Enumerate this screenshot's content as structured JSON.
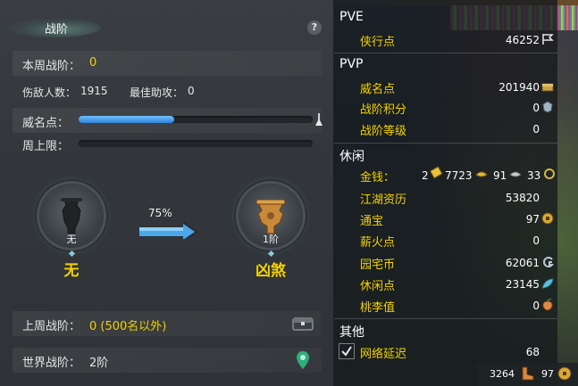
{
  "left": {
    "title": "战阶",
    "help_label": "?",
    "weekly_rank_label": "本周战阶：",
    "weekly_rank_value": "0",
    "kills_label": "伤敌人数：",
    "kills_value": "1915",
    "best_assist_label": "最佳助攻：",
    "best_assist_value": "0",
    "prestige_label": "威名点：",
    "prestige_progress": 0.41,
    "weekly_cap_label": "周上限：",
    "weekly_cap_progress": 0,
    "current_rank": {
      "level": "无",
      "name": "无"
    },
    "next_rank": {
      "level": "1阶",
      "name": "凶煞"
    },
    "progress_percent": "75%",
    "last_week_label": "上周战阶：",
    "last_week_value": "0 (500名以外)",
    "world_rank_label": "世界战阶：",
    "world_rank_value": "2阶"
  },
  "right": {
    "pve": {
      "header": "PVE",
      "items": [
        {
          "label": "侠行点",
          "value": "46252",
          "icon": "flag-icon"
        }
      ]
    },
    "pvp": {
      "header": "PVP",
      "items": [
        {
          "label": "威名点",
          "value": "201940",
          "icon": "chest-icon"
        },
        {
          "label": "战阶积分",
          "value": "0",
          "icon": "badge-icon"
        },
        {
          "label": "战阶等级",
          "value": "0"
        }
      ]
    },
    "leisure": {
      "header": "休闲",
      "money_label": "金钱：",
      "money": {
        "gold": "2",
        "silver": "7723",
        "copper_a": "91",
        "copper_b": "33"
      },
      "items": [
        {
          "label": "江湖资历",
          "value": "53820"
        },
        {
          "label": "通宝",
          "value": "97",
          "icon": "coin-icon"
        },
        {
          "label": "薪火点",
          "value": "0"
        },
        {
          "label": "园宅币",
          "value": "62061",
          "icon": "house-coin-icon"
        },
        {
          "label": "休闲点",
          "value": "23145",
          "icon": "leaf-icon"
        },
        {
          "label": "桃李值",
          "value": "0",
          "icon": "peach-icon"
        }
      ]
    },
    "other": {
      "header": "其他",
      "network_label": "网络延迟",
      "network_value": "68",
      "network_checked": true
    },
    "bottom": {
      "left_value": "3264",
      "right_value": "97"
    }
  },
  "colors": {
    "accent_yellow": "#f4d100",
    "bar_blue": "#2f82d6"
  }
}
